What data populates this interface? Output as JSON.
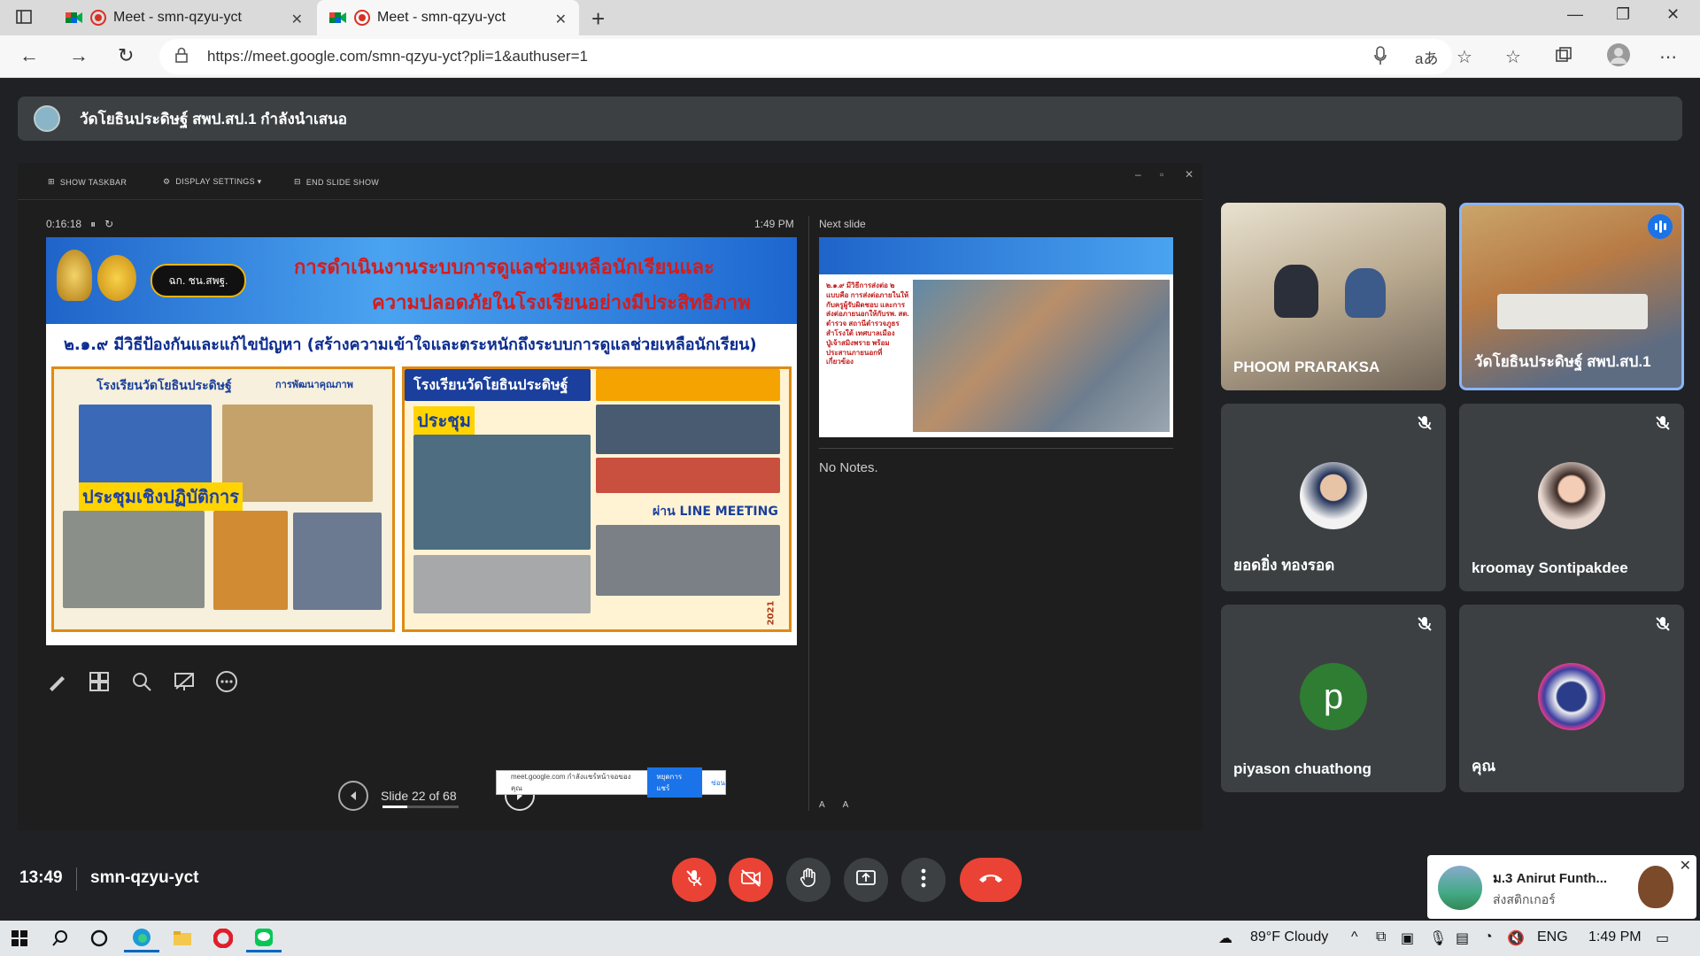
{
  "browser": {
    "tabs": [
      {
        "title": "Meet - smn-qzyu-yct",
        "active": false
      },
      {
        "title": "Meet - smn-qzyu-yct",
        "active": true
      }
    ],
    "url": "https://meet.google.com/smn-qzyu-yct?pli=1&authuser=1"
  },
  "presenter_banner": {
    "text": "วัดโยธินประดิษฐ์ สพป.สป.1 กำลังนำเสนอ"
  },
  "presentation": {
    "toolbar": {
      "show_taskbar": "SHOW TASKBAR",
      "display_settings": "DISPLAY SETTINGS ▾",
      "end_slide_show": "END SLIDE SHOW"
    },
    "timer": "0:16:18",
    "clock": "1:49 PM",
    "next_slide_label": "Next slide",
    "notes": "No Notes.",
    "slide_counter": "Slide 22 of 68",
    "progress": 0.32,
    "slide": {
      "title_line1": "การดำเนินงานระบบการดูแลช่วยเหลือนักเรียนและ",
      "title_line2": "ความปลอดภัยในโรงเรียนอย่างมีประสิทธิภาพ",
      "subtitle": "๒.๑.๙ มีวิธีป้องกันและแก้ไขปัญหา (สร้างความเข้าใจและตระหนักถึงระบบการดูแลช่วยเหลือนักเรียน)",
      "school_left": "โรงเรียนวัดโยธินประดิษฐ์",
      "dev_label": "การพัฒนาคุณภาพ",
      "meeting_label": "ประชุมเชิงปฏิบัติการ",
      "school_mid": "โรงเรียนวัดโยธินประดิษฐ์",
      "meeting_mid": "ประชุม",
      "line_meeting": "ผ่าน LINE MEETING",
      "year": "2021",
      "dept_badge": "ฉก. ชน.สพฐ."
    },
    "next": {
      "text": "๒.๑.๙ มีวิธีการส่งต่อ ๒ แบบคือ การส่งต่อภายในให้กับครูผู้รับผิดชอบ และการส่งต่อภายนอกให้กับรพ. สต. ตำรวจ สถานีตำรวจภูธรสำโรงใต้ เทศบาลเมืองปู่เจ้าสมิงพราย พร้อมประสานภายนอกที่เกี่ยวข้อง"
    },
    "popup": {
      "text": "meet.google.com กำลังแชร์หน้าจอของคุณ",
      "button": "หยุดการแชร์",
      "link": "ซ่อน"
    },
    "font_controls": [
      "A",
      "A"
    ]
  },
  "participants": [
    {
      "name": "PHOOM PRARAKSA",
      "type": "video",
      "muted": false
    },
    {
      "name": "วัดโยธินประดิษฐ์ สพป.สป.1",
      "type": "video",
      "muted": false,
      "speaking": true
    },
    {
      "name": "ยอดยิ่ง ทองรอด",
      "type": "avatar",
      "muted": true
    },
    {
      "name": "kroomay Sontipakdee",
      "type": "avatar",
      "muted": true
    },
    {
      "name": "piyason chuathong",
      "type": "letter",
      "letter": "p",
      "muted": true,
      "color": "#2e7d32"
    },
    {
      "name": "คุณ",
      "type": "avatar",
      "muted": true
    }
  ],
  "meeting": {
    "time": "13:49",
    "code": "smn-qzyu-yct"
  },
  "notification": {
    "title": "ม.3 Anirut Funth...",
    "body": "ส่งสติกเกอร์"
  },
  "taskbar": {
    "weather": "89°F  Cloudy",
    "language": "ENG",
    "clock": "1:49 PM"
  },
  "colors": {
    "meet_bg": "#202124",
    "tile_bg": "#3c4043",
    "danger": "#ea4335",
    "accent": "#1a73e8",
    "speaking_border": "#8ab4f8"
  }
}
